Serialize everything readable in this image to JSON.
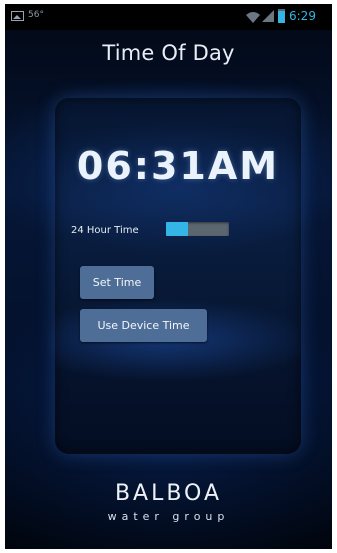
{
  "status_bar": {
    "temperature": "56°",
    "time": "6:29",
    "icons": [
      "image-icon",
      "wifi-icon",
      "signal-icon",
      "battery-icon"
    ]
  },
  "page_title": "Time Of Day",
  "clock": {
    "display": "06:31AM"
  },
  "hour_toggle": {
    "label": "24 Hour Time",
    "state": "off",
    "fill_fraction": 0.35
  },
  "buttons": {
    "set_time": "Set Time",
    "use_device_time": "Use Device Time"
  },
  "logo": {
    "brand": "BALBOA",
    "tagline": "water group"
  },
  "colors": {
    "accent": "#33b5e5",
    "button": "#4e6e98",
    "background": "#061636"
  }
}
